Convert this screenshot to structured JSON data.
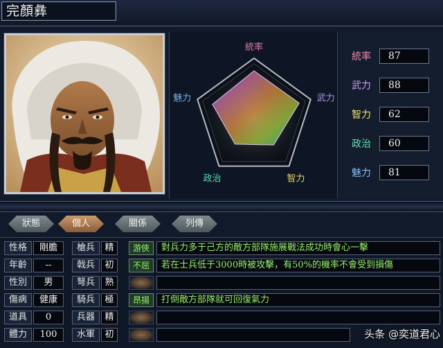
{
  "general": {
    "name": "完顏彝"
  },
  "radar": {
    "axes": [
      "統率",
      "武力",
      "智力",
      "政治",
      "魅力"
    ],
    "values": [
      87,
      88,
      62,
      60,
      81
    ],
    "max": 100,
    "colors": {
      "統率": "#e07da0",
      "武力": "#b58fe0",
      "智力": "#e8d860",
      "政治": "#58d8b0",
      "魅力": "#78b0f0"
    }
  },
  "stats": [
    {
      "label": "統率",
      "value": "87",
      "color": "#f08cac"
    },
    {
      "label": "武力",
      "value": "88",
      "color": "#c9a0f0"
    },
    {
      "label": "智力",
      "value": "62",
      "color": "#f0e070"
    },
    {
      "label": "政治",
      "value": "60",
      "color": "#66e0b8"
    },
    {
      "label": "魅力",
      "value": "81",
      "color": "#86bcf4"
    }
  ],
  "tabs": [
    {
      "label": "狀態",
      "active": false
    },
    {
      "label": "個人",
      "active": true
    },
    {
      "label": "關係",
      "active": false
    },
    {
      "label": "列傳",
      "active": false
    }
  ],
  "info": {
    "personality": {
      "label": "性格",
      "value": "剛膽"
    },
    "age": {
      "label": "年齡",
      "value": "--"
    },
    "gender": {
      "label": "性別",
      "value": "男"
    },
    "condition": {
      "label": "傷病",
      "value": "健康"
    },
    "items": {
      "label": "道具",
      "value": "0"
    },
    "stamina": {
      "label": "體力",
      "value": "100"
    }
  },
  "aptitude": [
    {
      "label": "槍兵",
      "value": "精"
    },
    {
      "label": "戟兵",
      "value": "初"
    },
    {
      "label": "弩兵",
      "value": "熟"
    },
    {
      "label": "騎兵",
      "value": "極"
    },
    {
      "label": "兵器",
      "value": "精"
    },
    {
      "label": "水軍",
      "value": "初"
    }
  ],
  "skills": [
    {
      "name": "游俠",
      "desc": "對兵力多于己方的敵方部隊施展戰法成功時會心一擊"
    },
    {
      "name": "不屈",
      "desc": "若在士兵低于3000時被攻擊，有50%的機率不會受到損傷"
    },
    {
      "name": "",
      "desc": ""
    },
    {
      "name": "昂揚",
      "desc": "打倒敵方部隊就可回復氣力"
    },
    {
      "name": "",
      "desc": ""
    },
    {
      "name": "",
      "desc": ""
    }
  ],
  "watermark": "头条 @奕道君心"
}
